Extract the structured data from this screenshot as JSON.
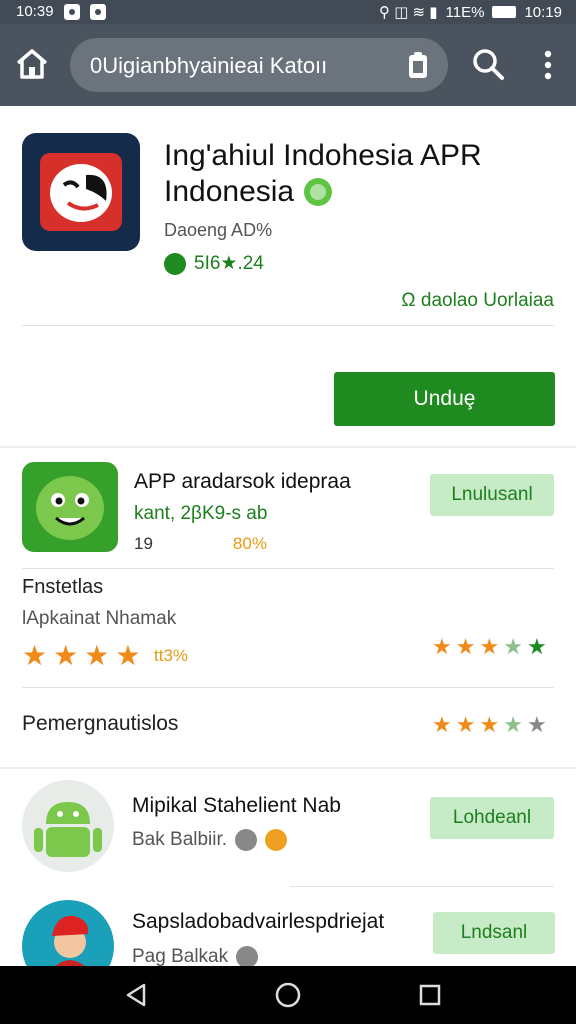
{
  "status_bar": {
    "time_left": "10:39",
    "battery": "11E%",
    "time_right": "10:19"
  },
  "search": {
    "query": "0Uigianbhyainieai Katoıı"
  },
  "app": {
    "title_line1": "Ing'ahiul Indohesia APR",
    "title_line2": "Indonesia",
    "developer": "Daoeng AD%",
    "rating": "5I6★.24",
    "wishlist": "Ω daolao Uorlaiaa",
    "install_label": "Unduȩ"
  },
  "related": [
    {
      "name": "APP aradarsok idepraa",
      "sub": "kant, 2βK9-s ab",
      "meta_a": "19",
      "meta_b": "80%",
      "button": "Lnulusanl"
    },
    {
      "name": "Mipikal Stahelient Nab",
      "sub": "Bak Balbiir.",
      "button": "Lohdeanl"
    },
    {
      "name": "Sapsladobadvairlespdriejat",
      "sub": "Pag Balkak",
      "button": "Lndsanl"
    }
  ],
  "rating_section": {
    "title": "Fnstetlas",
    "subtitle": "lApkainat Nhamak",
    "percent": "tt3%",
    "pref_label": "Pemergnautislos"
  },
  "icons": [
    "home-icon",
    "clipboard-icon",
    "search-icon",
    "more-vert-icon",
    "back-icon",
    "home-circle-icon",
    "recents-icon"
  ],
  "colors": {
    "accent": "#1f8a1f",
    "appbar": "#4b545e",
    "star": "#f08a18"
  }
}
